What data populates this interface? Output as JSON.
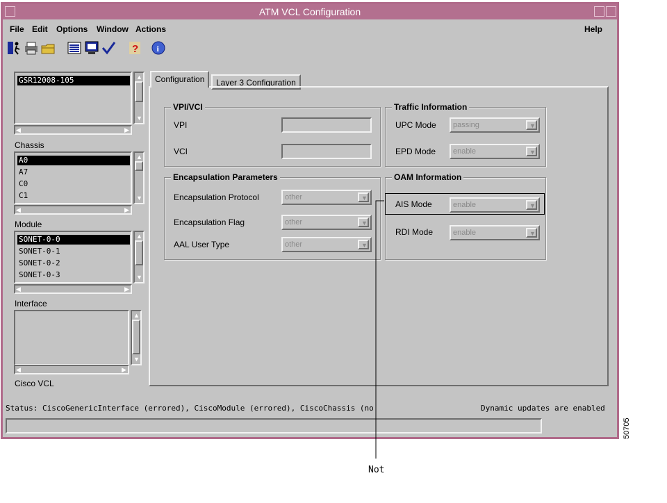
{
  "window": {
    "title": "ATM VCL Configuration"
  },
  "menu": {
    "file": "File",
    "edit": "Edit",
    "options": "Options",
    "window": "Window",
    "actions": "Actions",
    "help": "Help"
  },
  "sidebar": {
    "device_list": [
      "GSR12008-105"
    ],
    "chassis_label": "Chassis",
    "chassis_list": [
      "A0",
      "A7",
      "C0",
      "C1"
    ],
    "module_label": "Module",
    "module_list": [
      "SONET-0-0",
      "SONET-0-1",
      "SONET-0-2",
      "SONET-0-3"
    ],
    "interface_label": "Interface",
    "ciscovcl_label": "Cisco VCL"
  },
  "tabs": {
    "configuration": "Configuration",
    "layer3": "Layer 3 Configuration"
  },
  "vpivci": {
    "title": "VPI/VCI",
    "vpi": "VPI",
    "vci": "VCI"
  },
  "traffic": {
    "title": "Traffic Information",
    "upc_label": "UPC Mode",
    "upc_value": "passing",
    "epd_label": "EPD Mode",
    "epd_value": "enable"
  },
  "encap": {
    "title": "Encapsulation Parameters",
    "protocol_label": "Encapsulation Protocol",
    "protocol_value": "other",
    "flag_label": "Encapsulation Flag",
    "flag_value": "other",
    "aal_label": "AAL User Type",
    "aal_value": "other"
  },
  "oam": {
    "title": "OAM Information",
    "ais_label": "AIS Mode",
    "ais_value": "enable",
    "rdi_label": "RDI Mode",
    "rdi_value": "enable"
  },
  "status": {
    "text": "Status: CiscoGenericInterface (errored), CiscoModule (errored), CiscoChassis (no",
    "updates": "Dynamic updates are enabled"
  },
  "callout": {
    "text": "Not"
  },
  "figure_id": "50705"
}
